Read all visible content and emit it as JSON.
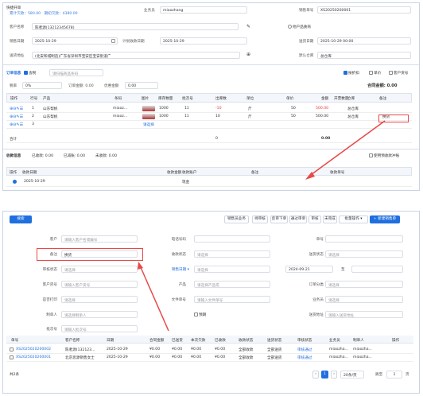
{
  "top": {
    "order_label": "快捷开单",
    "stats_text": "累计欠款：580.00　期初欠款：4380.00",
    "salesman_label": "业务员",
    "salesman_value": "miaozhang",
    "sales_no_label": "销售单号",
    "sales_no_value": "XS20250200001",
    "customer_label": "客户名称",
    "customer_value": "陈者源(13212345678)",
    "other_customer": "他户品质商",
    "sale_date_label": "销售日期",
    "sale_date_value": "2025-10-29",
    "plan_date_label": "计划收款日期",
    "plan_date_value": "2025-10-29",
    "delivery_date_label": "送货日期",
    "delivery_date_value": "2025-10-29 00:00",
    "address_label": "送货地址",
    "address_value": "(北安和城制造)广东省深圳市宝安区宝安街道广",
    "warehouse_label": "默认仓库",
    "warehouse_value": "总仓库",
    "tab_info": "订单信息",
    "tax_check": "含税",
    "product_search": "请扫描商品条码",
    "attach_label": "附加",
    "attach_sum": "合计",
    "opt_1": "按折扣",
    "opt_2": "单价",
    "opt_3": "客户货号",
    "discount_label": "税率",
    "discount_value": "0%",
    "order_amount_label": "订单金额: 0.00",
    "discount_amount_label": "优惠金额",
    "discount_amount_value": "0.00",
    "total_amount": "合同金额: 0.00"
  },
  "grid1": {
    "headers": [
      "操作",
      "行号",
      "产品",
      "条码",
      "图片",
      "库存数量",
      "批次号",
      "出库数",
      "单位",
      "单价",
      "金额",
      "开票数量",
      "仓库",
      "备注"
    ],
    "rows": [
      {
        "no": "1",
        "product": "山东帮帆",
        "code": "miaoz...",
        "stock": "1000",
        "batch": "11",
        "qty": "-10",
        "unit": "斤",
        "price": "50",
        "amount": "500.00",
        "store": "总仓库",
        "note": "",
        "red": true
      },
      {
        "no": "2",
        "product": "山东帮帆",
        "code": "miaoz...",
        "stock": "1000",
        "batch": "11",
        "qty": "10",
        "unit": "斤",
        "price": "50",
        "amount": "500.00",
        "store": "总仓库",
        "note": "换货",
        "red": false
      },
      {
        "no": "3",
        "product": "",
        "code": "",
        "stock": "请选择",
        "batch": "",
        "qty": "",
        "unit": "",
        "price": "",
        "amount": "",
        "store": "",
        "note": "",
        "red": false
      }
    ],
    "sum_label": "合计",
    "sum_qty": "0",
    "sum_amount": "0.00"
  },
  "receipt": {
    "title": "收款信息",
    "received": "已收款: 0.00",
    "deduct": "已减账: 0.00",
    "unpaid": "未收款: 0.00",
    "use_advance": "使用预收款冲账",
    "headers": [
      "操作",
      "收款日期",
      "收款金额",
      "收款账户",
      "备注",
      "收款单号"
    ],
    "row_date": "2025-10-29",
    "row_account": "现金"
  },
  "bottom": {
    "search_btn": "搜索",
    "btns": [
      "销售员业务",
      "待审核",
      "反审下单",
      "通过审单",
      "审核",
      "未完成",
      "批量操作 ▾",
      "+ 新建销售单"
    ],
    "filters": {
      "customer": "客户",
      "customer_ph": "请输入客户名或编号",
      "phone": "电话号码",
      "no": "单号",
      "note": "备注",
      "note_value": "换货",
      "collect": "收款状态",
      "collect_ph": "请选择",
      "delivery_state": "送货状态",
      "delivery_ph": "请选择",
      "audit": "审核状态",
      "audit_ph": "请选择",
      "sale_date": "销售日期 ▾",
      "date_ph": "请选择",
      "date_from": "2024-09-21",
      "date_to": "至",
      "cust_no": "客户货号",
      "cust_no_ph": "请输入客户货号",
      "product": "产品",
      "product_ph": "请选择产品或",
      "order_class": "订单分类",
      "order_class_ph": "请选择",
      "print": "是否打印",
      "print_ph": "请选择",
      "doc_no": "文件单号",
      "doc_no_ph": "请输入文件单号",
      "salesman": "业务员",
      "salesman_ph": "请选择",
      "maker": "制单人",
      "maker_ph": "请选择制单人",
      "overdue": "预期",
      "addr": "送货地址",
      "addr_ph": "请输入送货地址",
      "batch": "批次号",
      "batch_ph": "请输入批次号"
    },
    "table_headers": [
      "单号",
      "客户名称",
      "日期",
      "合同金额",
      "已送货",
      "本次欠款",
      "已收款",
      "收款状态",
      "送货状态",
      "审核状态",
      "业务员",
      "制单人",
      "操作"
    ],
    "rows": [
      {
        "no": "XS2025020200002",
        "customer": "陈者源(132123...",
        "date": "2025-10-29",
        "amount": "¥0.00",
        "delivered": "¥0.00",
        "debt": "¥0.00",
        "received": "¥0.00",
        "collect": "全部收款",
        "deliver": "全部送货",
        "audit": "审核通过",
        "sales": "miaozha...",
        "maker": "miaozha..."
      },
      {
        "no": "XS2025020200001",
        "customer": "北京思源销售女士",
        "date": "2025-10-29",
        "amount": "¥0.00",
        "delivered": "¥0.00",
        "debt": "¥0.00",
        "received": "¥0.00",
        "collect": "全部收款",
        "deliver": "全部送货",
        "audit": "审核通过",
        "sales": "miaozha...",
        "maker": "miaozha..."
      }
    ],
    "total": "共2条",
    "page": "1",
    "page_size": "20条/页",
    "goto": "跳至",
    "goto_value": "1",
    "page_unit": "页"
  }
}
